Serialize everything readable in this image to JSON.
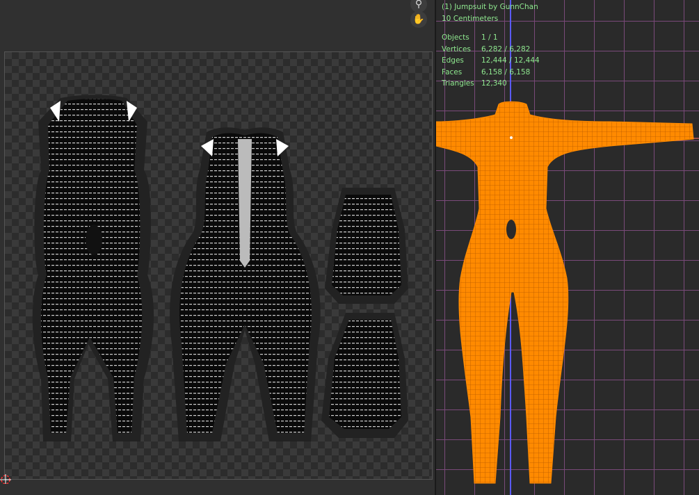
{
  "uv_editor": {
    "zoom_icon": "magnifier-icon",
    "pan_icon": "hand-icon",
    "cursor_icon": "2d-cursor-icon"
  },
  "viewport": {
    "object_title": "(1)  Jumpsuit by GunnChan",
    "scale_label": "10 Centimeters",
    "stats": [
      {
        "label": "Objects",
        "value": "1 / 1"
      },
      {
        "label": "Vertices",
        "value": "6,282 / 6,282"
      },
      {
        "label": "Edges",
        "value": "12,444 / 12,444"
      },
      {
        "label": "Faces",
        "value": "6,158 / 6,158"
      },
      {
        "label": "Triangles",
        "value": "12,340"
      }
    ],
    "colors": {
      "mesh": "#ff8a00",
      "grid": "#7a4a7a",
      "axis": "#5a5aff",
      "stats_text": "#8fe88f"
    }
  }
}
